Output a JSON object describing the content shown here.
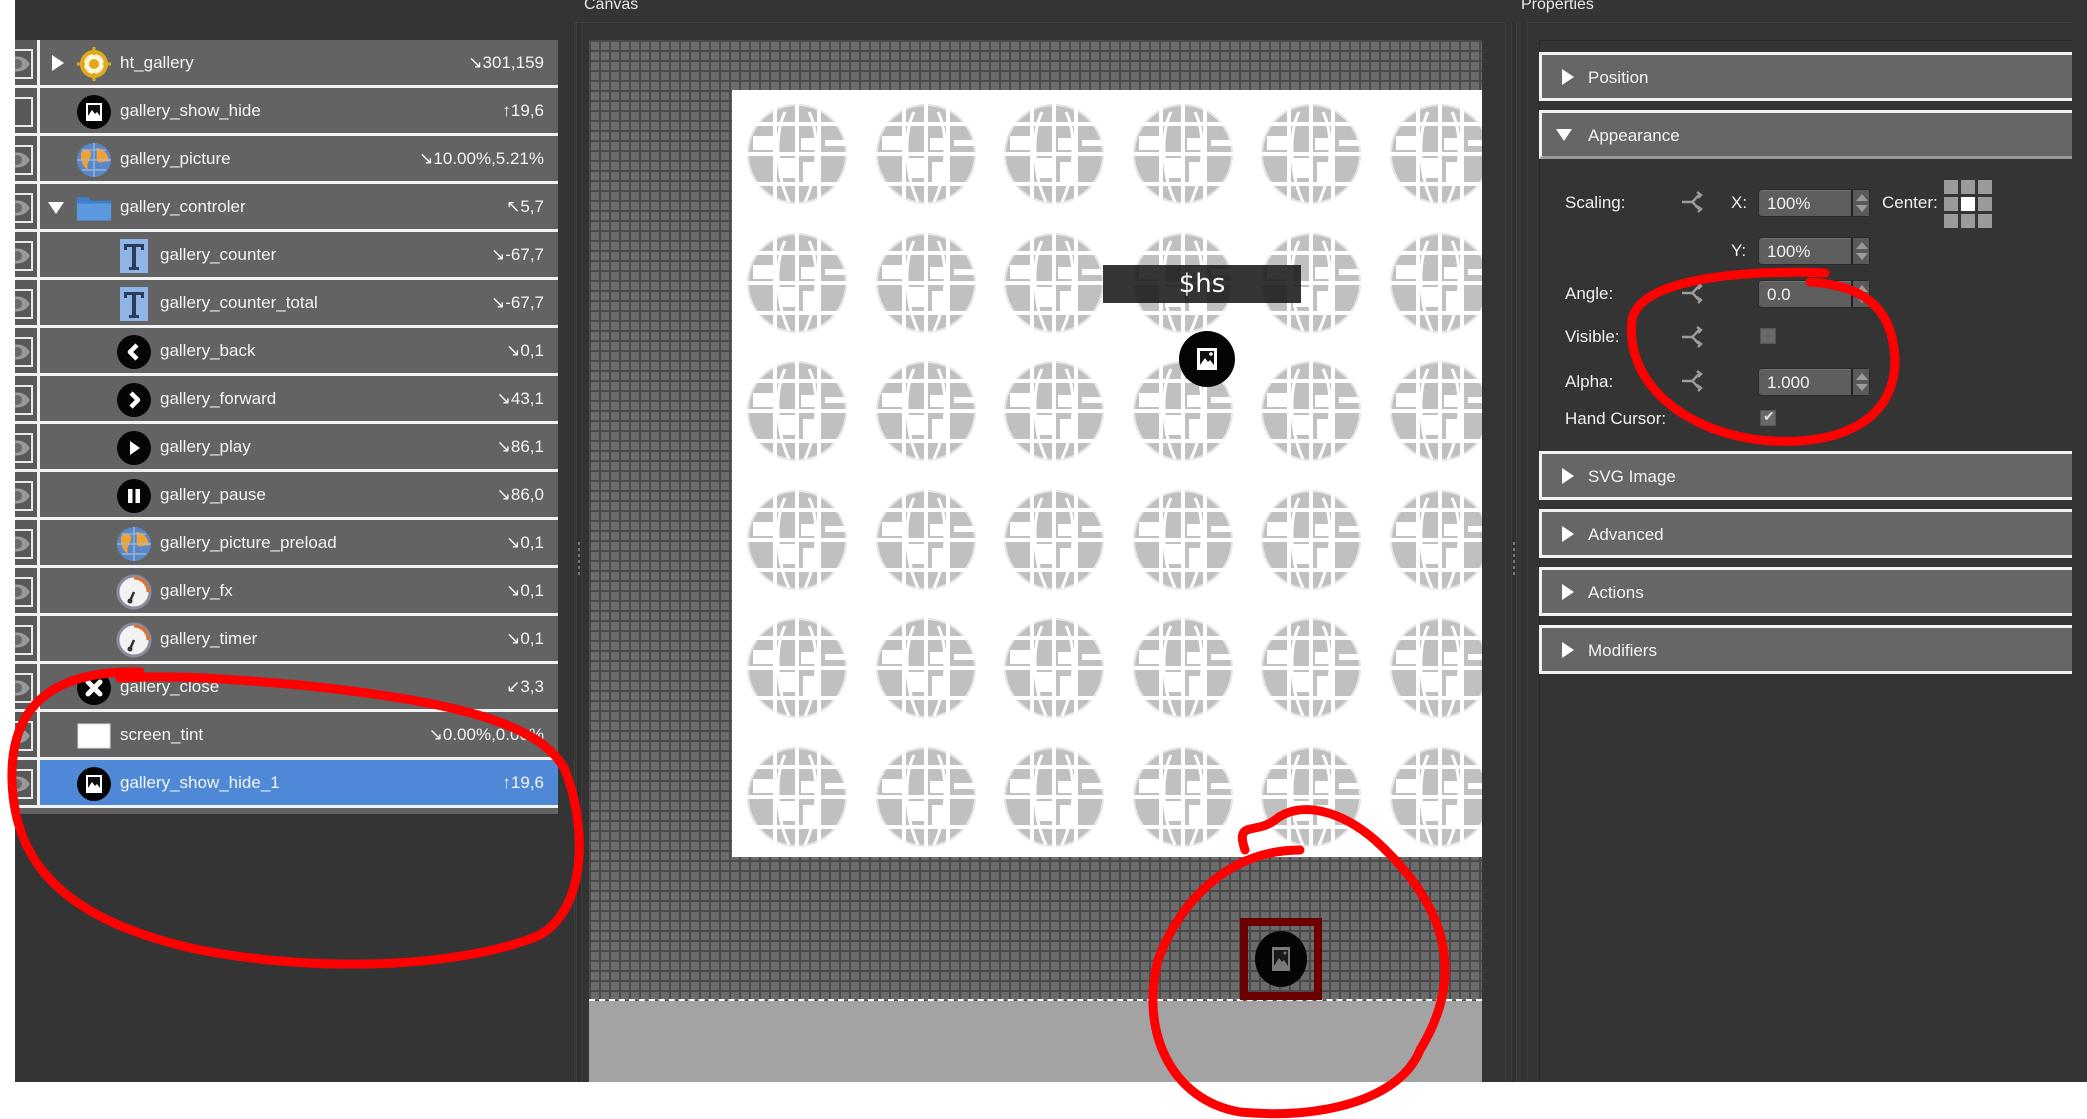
{
  "panels": {
    "canvas_title": "Canvas",
    "properties_title": "Properties"
  },
  "layers": [
    {
      "name": "ht_gallery",
      "value": "↘301,159",
      "icon": "hotspot-icon",
      "expander": "collapsed",
      "indent": 0,
      "visible_eye": true
    },
    {
      "name": "gallery_show_hide",
      "value": "↑19,6",
      "icon": "image-button-icon",
      "expander": "none",
      "indent": 0,
      "visible_eye": false
    },
    {
      "name": "gallery_picture",
      "value": "↘10.00%,5.21%",
      "icon": "globe-picture-icon",
      "expander": "none",
      "indent": 0,
      "visible_eye": true
    },
    {
      "name": "gallery_controler",
      "value": "↖5,7",
      "icon": "folder-icon",
      "expander": "expanded",
      "indent": 0,
      "visible_eye": true
    },
    {
      "name": "gallery_counter",
      "value": "↘-67,7",
      "icon": "text-icon",
      "expander": "none",
      "indent": 1,
      "visible_eye": true
    },
    {
      "name": "gallery_counter_total",
      "value": "↘-67,7",
      "icon": "text-icon",
      "expander": "none",
      "indent": 1,
      "visible_eye": true
    },
    {
      "name": "gallery_back",
      "value": "↘0,1",
      "icon": "back-icon",
      "expander": "none",
      "indent": 1,
      "visible_eye": true
    },
    {
      "name": "gallery_forward",
      "value": "↘43,1",
      "icon": "forward-icon",
      "expander": "none",
      "indent": 1,
      "visible_eye": true
    },
    {
      "name": "gallery_play",
      "value": "↘86,1",
      "icon": "play-icon",
      "expander": "none",
      "indent": 1,
      "visible_eye": true
    },
    {
      "name": "gallery_pause",
      "value": "↘86,0",
      "icon": "pause-icon",
      "expander": "none",
      "indent": 1,
      "visible_eye": true
    },
    {
      "name": "gallery_picture_preload",
      "value": "↘0,1",
      "icon": "globe-picture-icon",
      "expander": "none",
      "indent": 1,
      "visible_eye": true
    },
    {
      "name": "gallery_fx",
      "value": "↘0,1",
      "icon": "timer-icon",
      "expander": "none",
      "indent": 1,
      "visible_eye": true
    },
    {
      "name": "gallery_timer",
      "value": "↘0,1",
      "icon": "timer-icon",
      "expander": "none",
      "indent": 1,
      "visible_eye": true
    },
    {
      "name": "gallery_close",
      "value": "↙3,3",
      "icon": "close-icon",
      "expander": "none",
      "indent": 0,
      "visible_eye": true
    },
    {
      "name": "screen_tint",
      "value": "↘0.00%,0.00%",
      "icon": "rectangle-icon",
      "expander": "none",
      "indent": 0,
      "visible_eye": true
    },
    {
      "name": "gallery_show_hide_1",
      "value": "↑19,6",
      "icon": "image-button-icon",
      "expander": "none",
      "indent": 0,
      "visible_eye": true,
      "selected": true
    }
  ],
  "canvas": {
    "text_element": "$hs",
    "globe_rows": 6,
    "globe_cols": 6
  },
  "properties": {
    "sections": {
      "position": {
        "label": "Position",
        "expanded": false
      },
      "appearance": {
        "label": "Appearance",
        "expanded": true
      },
      "svg_image": {
        "label": "SVG Image",
        "expanded": false
      },
      "advanced": {
        "label": "Advanced",
        "expanded": false
      },
      "actions": {
        "label": "Actions",
        "expanded": false
      },
      "modifiers": {
        "label": "Modifiers",
        "expanded": false
      }
    },
    "appearance": {
      "scaling_label": "Scaling:",
      "x_label": "X:",
      "x_value": "100%",
      "y_label": "Y:",
      "y_value": "100%",
      "center_label": "Center:",
      "center_selected": "middle-center",
      "angle_label": "Angle:",
      "angle_value": "0.0",
      "visible_label": "Visible:",
      "visible_checked": false,
      "alpha_label": "Alpha:",
      "alpha_value": "1.000",
      "hand_cursor_label": "Hand Cursor:",
      "hand_cursor_checked": true,
      "tick_glyph": "✔"
    }
  },
  "colors": {
    "panel_bg": "#343434",
    "row_bg": "#636363",
    "selected_row": "#4f88d6",
    "annotation_red": "#ff0000",
    "selection_frame": "#6b0000"
  }
}
